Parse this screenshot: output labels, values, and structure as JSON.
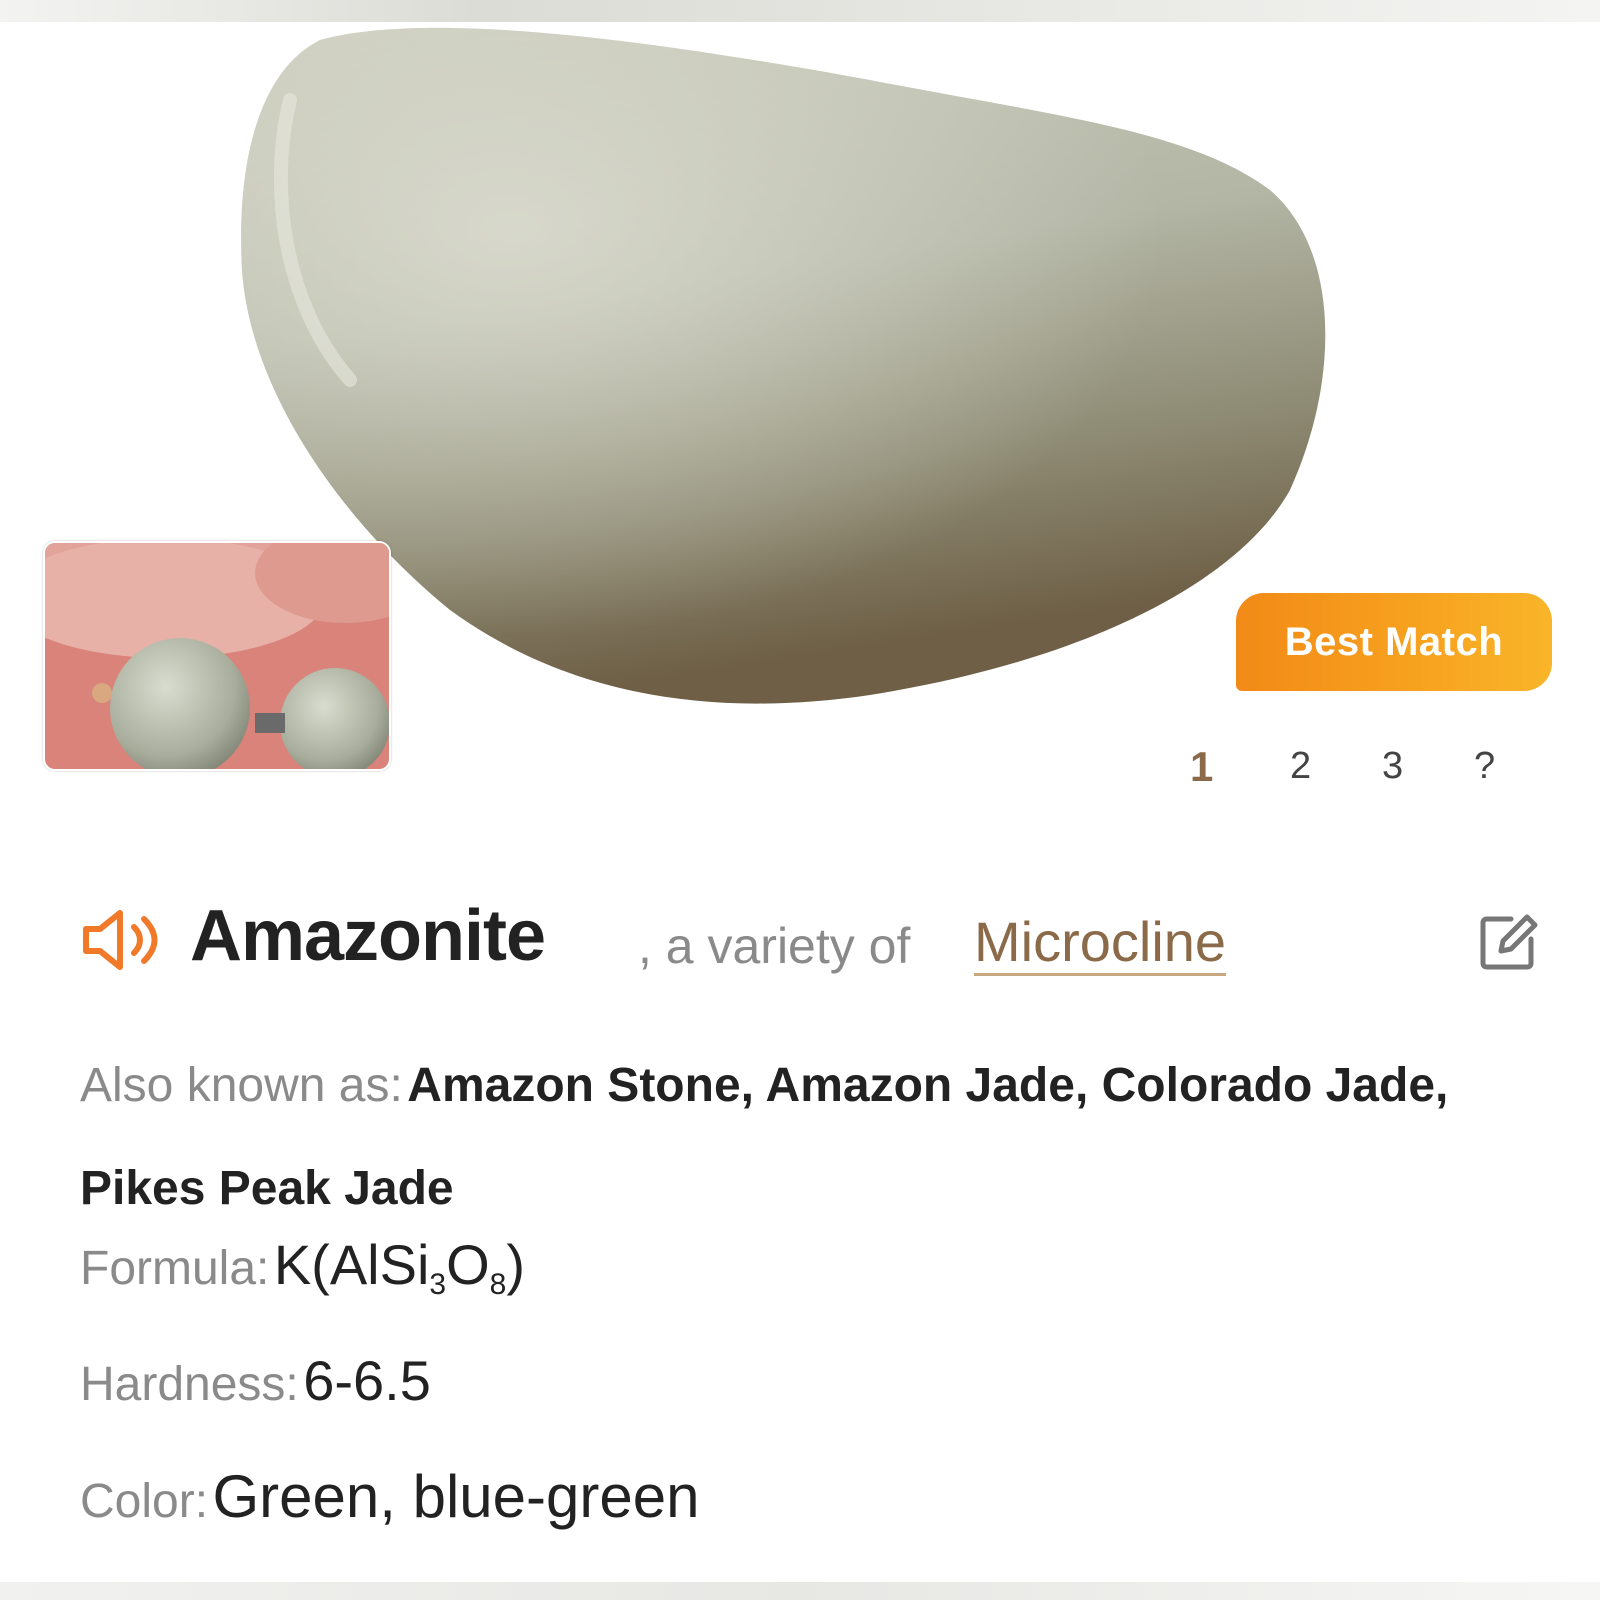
{
  "badge": {
    "label": "Best Match"
  },
  "pager": {
    "pages": [
      "1",
      "2",
      "3",
      "?"
    ]
  },
  "result": {
    "name": "Amazonite",
    "variety_prefix": ", a variety of",
    "variety_link": "Microcline"
  },
  "details": {
    "aka_label": "Also known as:",
    "aka_value": "Amazon Stone, Amazon Jade, Colorado Jade, Pikes Peak Jade",
    "formula_label": "Formula:",
    "formula_parts": [
      "K(AlSi",
      "3",
      "O",
      "8",
      ")"
    ],
    "hardness_label": "Hardness:",
    "hardness_value": "6-6.5",
    "color_label": "Color:",
    "color_value": "Green, blue-green"
  },
  "colors": {
    "accent_orange": "#f28a17",
    "link_brown": "#8a6a48",
    "label_gray": "#8a8a8a",
    "value_dark": "#222222"
  },
  "icons": {
    "speaker": "speaker-icon",
    "edit": "edit-icon"
  }
}
